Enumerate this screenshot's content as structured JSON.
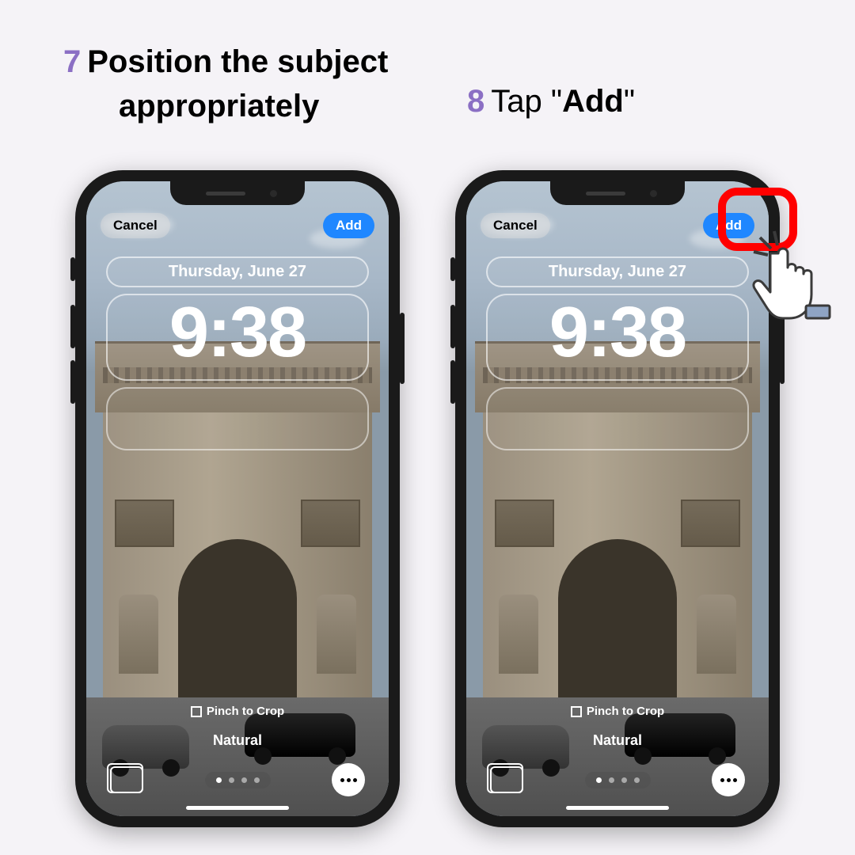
{
  "steps": {
    "left": {
      "number": "7",
      "line1": "Position the subject",
      "line2": "appropriately"
    },
    "right": {
      "number": "8",
      "prefix": "Tap ",
      "quote_open": "\"",
      "bold": "Add",
      "quote_close": "\""
    }
  },
  "phone": {
    "cancel_label": "Cancel",
    "add_label": "Add",
    "date_label": "Thursday, June 27",
    "time_label": "9:38",
    "pinch_label": "Pinch to Crop",
    "filter_label": "Natural"
  }
}
